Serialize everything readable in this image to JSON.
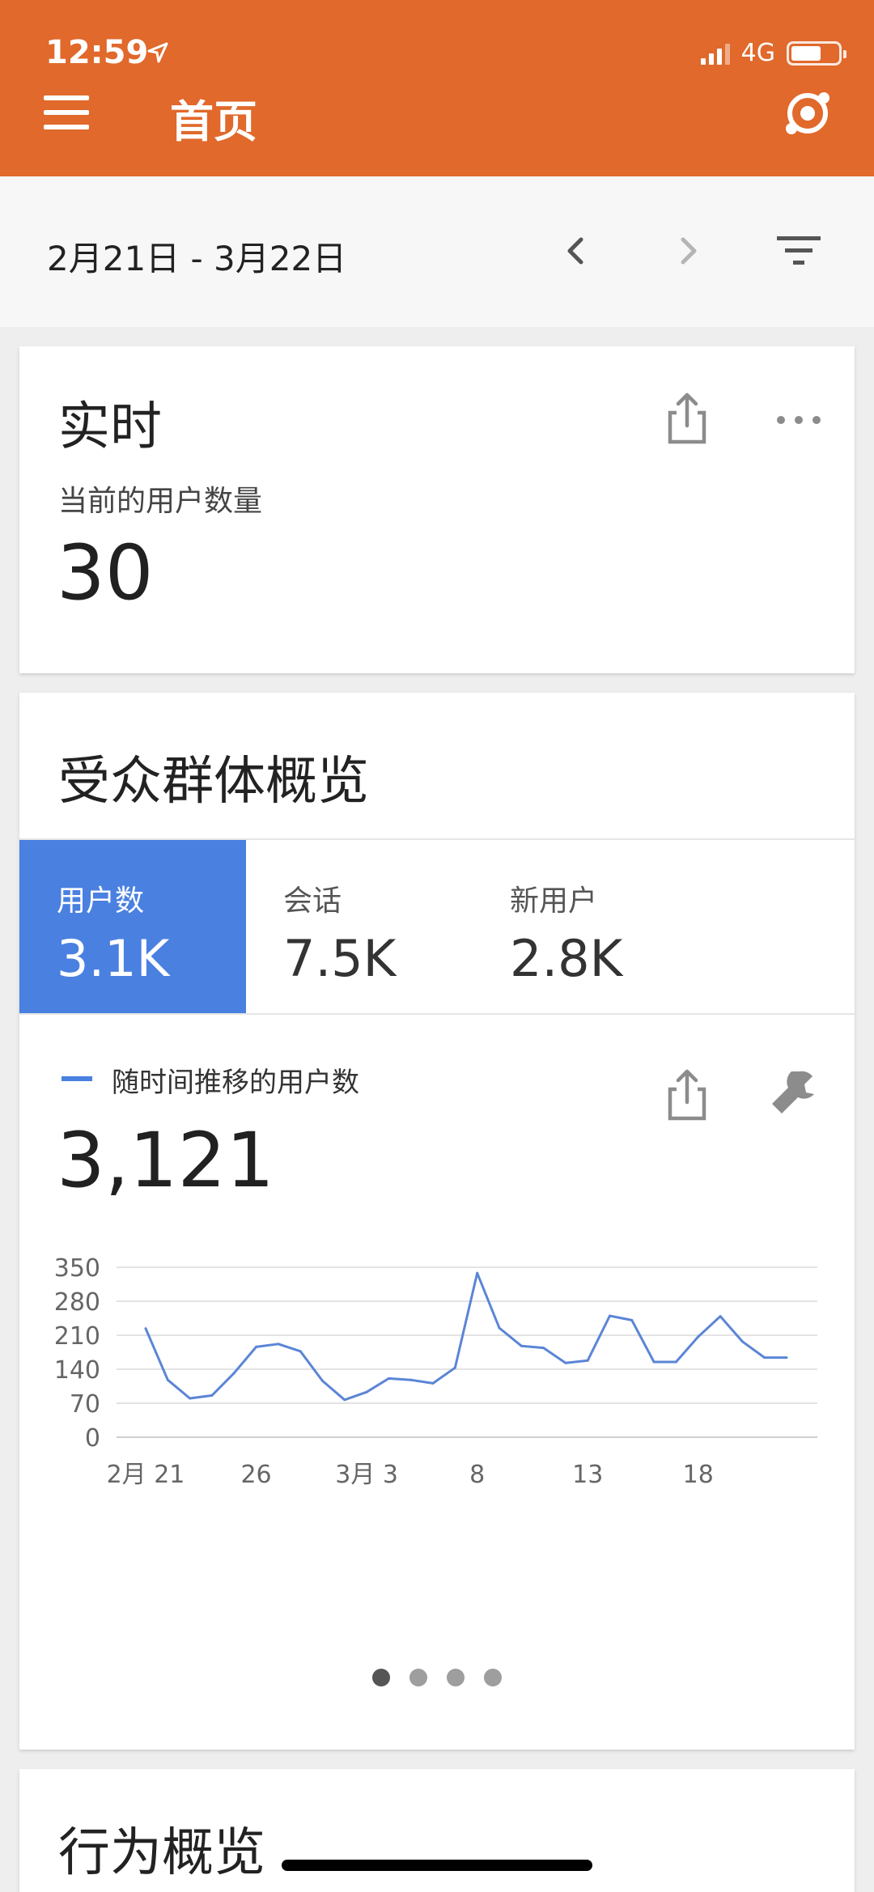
{
  "status": {
    "time": "12:59",
    "network": "4G"
  },
  "appbar": {
    "title": "首页"
  },
  "datebar": {
    "range": "2月21日 - 3月22日"
  },
  "realtime": {
    "title": "实时",
    "label": "当前的用户数量",
    "value": "30"
  },
  "audience": {
    "title": "受众群体概览",
    "tabs": [
      {
        "label": "用户数",
        "value": "3.1K",
        "active": true
      },
      {
        "label": "会话",
        "value": "7.5K",
        "active": false
      },
      {
        "label": "新用户",
        "value": "2.8K",
        "active": false
      }
    ],
    "legend": "随时间推移的用户数",
    "total": "3,121",
    "dots": 4,
    "active_dot": 0
  },
  "chart_data": {
    "type": "line",
    "series": [
      {
        "name": "随时间推移的用户数",
        "color": "#5b85d6",
        "x": [
          "2/21",
          "2/22",
          "2/23",
          "2/24",
          "2/25",
          "2/26",
          "2/27",
          "2/28",
          "3/1",
          "3/2",
          "3/3",
          "3/4",
          "3/5",
          "3/6",
          "3/7",
          "3/8",
          "3/9",
          "3/10",
          "3/11",
          "3/12",
          "3/13",
          "3/14",
          "3/15",
          "3/16",
          "3/17",
          "3/18",
          "3/19",
          "3/20",
          "3/21",
          "3/22"
        ],
        "values": [
          224,
          118,
          80,
          86,
          132,
          186,
          192,
          177,
          116,
          77,
          93,
          121,
          118,
          111,
          143,
          338,
          225,
          188,
          184,
          153,
          158,
          250,
          241,
          155,
          155,
          207,
          249,
          197,
          164,
          164
        ]
      }
    ],
    "yticks": [
      "350",
      "280",
      "210",
      "140",
      "70",
      "0"
    ],
    "xticks": [
      {
        "label": "2月 21",
        "day": 0
      },
      {
        "label": "26",
        "day": 5
      },
      {
        "label": "3月 3",
        "day": 10
      },
      {
        "label": "8",
        "day": 15
      },
      {
        "label": "13",
        "day": 20
      },
      {
        "label": "18",
        "day": 25
      }
    ],
    "ylim": [
      0,
      350
    ],
    "grid": true
  },
  "behavior": {
    "title": "行为概览"
  }
}
